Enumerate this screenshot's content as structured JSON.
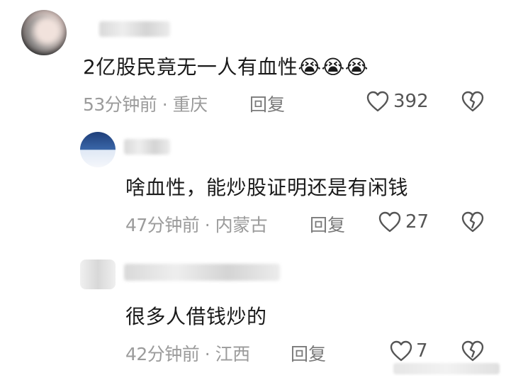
{
  "comments": [
    {
      "text": "2亿股民竟无一人有血性",
      "emoji": [
        "😭",
        "😭",
        "😭"
      ],
      "time": "53分钟前",
      "location": "重庆",
      "reply_label": "回复",
      "likes": "392"
    },
    {
      "text": "啥血性，能炒股证明还是有闲钱",
      "time": "47分钟前",
      "location": "内蒙古",
      "reply_label": "回复",
      "likes": "27"
    },
    {
      "text": "很多人借钱炒的",
      "time": "42分钟前",
      "location": "江西",
      "reply_label": "回复",
      "likes": "7"
    }
  ],
  "separator": "·",
  "icons": {
    "like": "heart-outline-icon",
    "dislike": "broken-heart-icon"
  },
  "colors": {
    "text": "#1a1a1a",
    "meta": "#9b9b9b",
    "reply": "#7a7a7a",
    "icon": "#555555"
  }
}
